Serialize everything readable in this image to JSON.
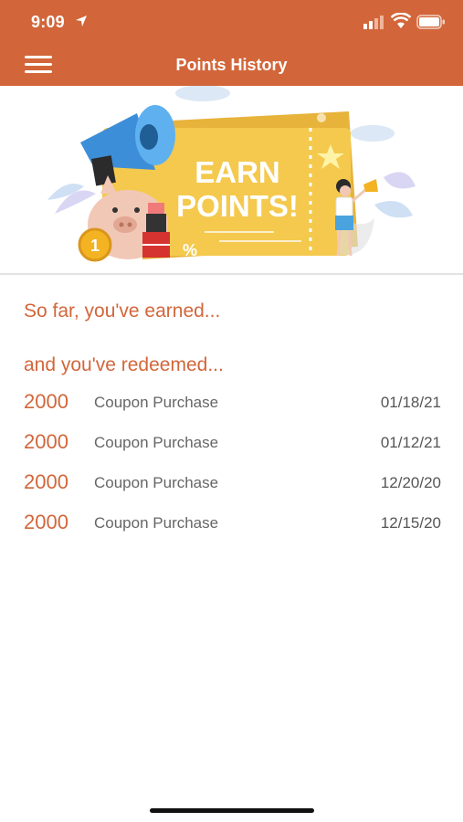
{
  "status_bar": {
    "time": "9:09"
  },
  "header": {
    "title": "Points History"
  },
  "banner": {
    "line1": "EARN",
    "line2": "POINTS!",
    "coin_label": "1",
    "percent": "%"
  },
  "summary": {
    "earned_label": "So far, you've earned...",
    "redeemed_label": "and you've redeemed..."
  },
  "redemptions": [
    {
      "points": "2000",
      "description": "Coupon Purchase",
      "date": "01/18/21"
    },
    {
      "points": "2000",
      "description": "Coupon Purchase",
      "date": "01/12/21"
    },
    {
      "points": "2000",
      "description": "Coupon Purchase",
      "date": "12/20/20"
    },
    {
      "points": "2000",
      "description": "Coupon Purchase",
      "date": "12/15/20"
    }
  ],
  "colors": {
    "accent": "#D2663A",
    "banner_yellow": "#F4C94D",
    "text_gray": "#666666"
  }
}
